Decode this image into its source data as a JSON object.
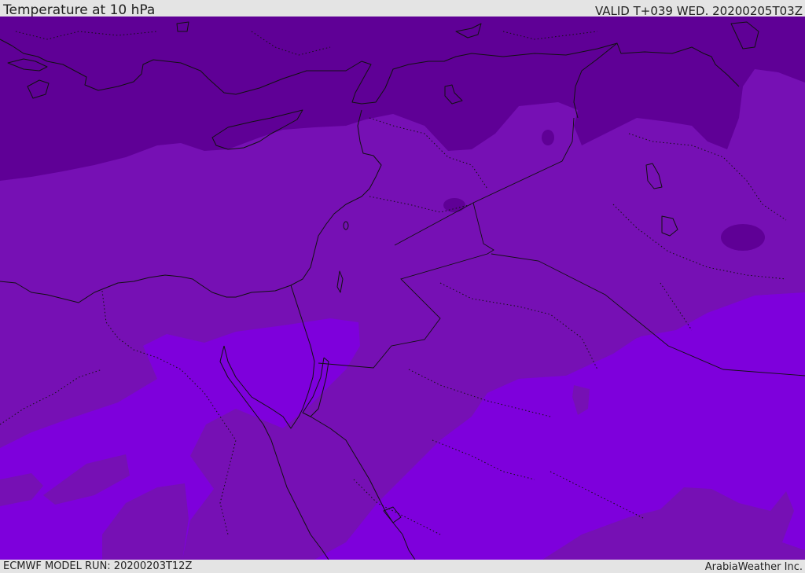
{
  "header": {
    "title": "Temperature at 10 hPa",
    "valid": "VALID T+039 WED. 20200205T03Z"
  },
  "footer": {
    "model_run": "ECMWF MODEL RUN: 20200203T12Z",
    "credit": "ArabiaWeather Inc."
  },
  "map": {
    "field": "temperature",
    "level": "10 hPa",
    "colors": {
      "darkest": "#5f0096",
      "dark": "#7610b4",
      "mid": "#7a10c0",
      "light": "#7e00dc",
      "patch": "#7a0cc8"
    }
  }
}
